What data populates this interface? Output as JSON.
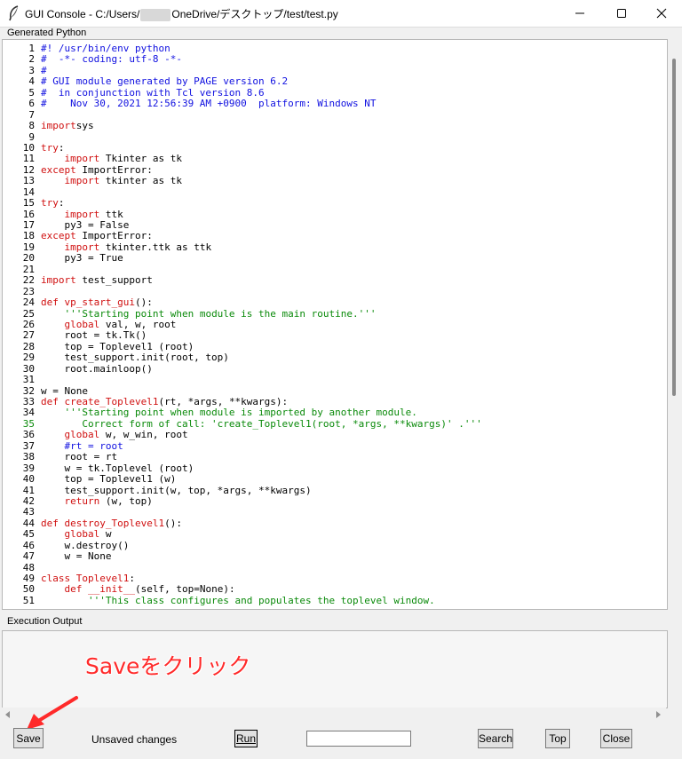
{
  "window": {
    "title_prefix": "GUI Console - C:/Users/",
    "title_suffix": "OneDrive/デスクトップ/test/test.py"
  },
  "editor": {
    "label": "Generated Python",
    "lines": [
      [
        [
          "cm",
          "#! /usr/bin/env python"
        ]
      ],
      [
        [
          "cm",
          "#  -*- coding: utf-8 -*-"
        ]
      ],
      [
        [
          "cm",
          "#"
        ]
      ],
      [
        [
          "cm",
          "# GUI module generated by PAGE version 6.2"
        ]
      ],
      [
        [
          "cm",
          "#  in conjunction with Tcl version 8.6"
        ]
      ],
      [
        [
          "cm",
          "#    Nov 30, 2021 12:56:39 AM +0900  platform: Windows NT"
        ]
      ],
      [],
      [
        [
          "kw",
          "import"
        ],
        [
          "",
          "sys"
        ]
      ],
      [],
      [
        [
          "kw",
          "try"
        ],
        [
          "",
          ":"
        ]
      ],
      [
        [
          "",
          "    "
        ],
        [
          "kw",
          "import"
        ],
        [
          "",
          " Tkinter as tk"
        ]
      ],
      [
        [
          "kw",
          "except"
        ],
        [
          "",
          " ImportError:"
        ]
      ],
      [
        [
          "",
          "    "
        ],
        [
          "kw",
          "import"
        ],
        [
          "",
          " tkinter as tk"
        ]
      ],
      [],
      [
        [
          "kw",
          "try"
        ],
        [
          "",
          ":"
        ]
      ],
      [
        [
          "",
          "    "
        ],
        [
          "kw",
          "import"
        ],
        [
          "",
          " ttk"
        ]
      ],
      [
        [
          "",
          "    py3 = False"
        ]
      ],
      [
        [
          "kw",
          "except"
        ],
        [
          "",
          " ImportError:"
        ]
      ],
      [
        [
          "",
          "    "
        ],
        [
          "kw",
          "import"
        ],
        [
          "",
          " tkinter.ttk as ttk"
        ]
      ],
      [
        [
          "",
          "    py3 = True"
        ]
      ],
      [],
      [
        [
          "kw",
          "import"
        ],
        [
          "",
          " test_support"
        ]
      ],
      [],
      [
        [
          "kw",
          "def"
        ],
        [
          "",
          " "
        ],
        [
          "fn",
          "vp_start_gui"
        ],
        [
          "",
          "():"
        ]
      ],
      [
        [
          "",
          "    "
        ],
        [
          "st",
          "'''Starting point when module is the main routine.'''"
        ]
      ],
      [
        [
          "",
          "    "
        ],
        [
          "kw",
          "global"
        ],
        [
          "",
          " val, w, root"
        ]
      ],
      [
        [
          "",
          "    root = tk.Tk()"
        ]
      ],
      [
        [
          "",
          "    top = Toplevel1 (root)"
        ]
      ],
      [
        [
          "",
          "    test_support.init(root, top)"
        ]
      ],
      [
        [
          "",
          "    root.mainloop()"
        ]
      ],
      [],
      [
        [
          "",
          "w = None"
        ]
      ],
      [
        [
          "kw",
          "def"
        ],
        [
          "",
          " "
        ],
        [
          "fn",
          "create_Toplevel1"
        ],
        [
          "",
          "(rt, *args, **kwargs):"
        ]
      ],
      [
        [
          "",
          "    "
        ],
        [
          "st",
          "'''Starting point when module is imported by another module."
        ]
      ],
      [
        [
          "st",
          "       Correct form of call: 'create_Toplevel1(root, *args, **kwargs)' .'''"
        ]
      ],
      [
        [
          "",
          "    "
        ],
        [
          "kw",
          "global"
        ],
        [
          "",
          " w, w_win, root"
        ]
      ],
      [
        [
          "",
          "    "
        ],
        [
          "cm",
          "#rt = root"
        ]
      ],
      [
        [
          "",
          "    root = rt"
        ]
      ],
      [
        [
          "",
          "    w = tk.Toplevel (root)"
        ]
      ],
      [
        [
          "",
          "    top = Toplevel1 (w)"
        ]
      ],
      [
        [
          "",
          "    test_support.init(w, top, *args, **kwargs)"
        ]
      ],
      [
        [
          "",
          "    "
        ],
        [
          "kw",
          "return"
        ],
        [
          "",
          " (w, top)"
        ]
      ],
      [],
      [
        [
          "kw",
          "def"
        ],
        [
          "",
          " "
        ],
        [
          "fn",
          "destroy_Toplevel1"
        ],
        [
          "",
          "():"
        ]
      ],
      [
        [
          "",
          "    "
        ],
        [
          "kw",
          "global"
        ],
        [
          "",
          " w"
        ]
      ],
      [
        [
          "",
          "    w.destroy()"
        ]
      ],
      [
        [
          "",
          "    w = None"
        ]
      ],
      [],
      [
        [
          "kw",
          "class"
        ],
        [
          "",
          " "
        ],
        [
          "cls",
          "Toplevel1"
        ],
        [
          "",
          ":"
        ]
      ],
      [
        [
          "",
          "    "
        ],
        [
          "kw",
          "def"
        ],
        [
          "",
          " "
        ],
        [
          "fn",
          "__init__"
        ],
        [
          "",
          "(self, top=None):"
        ]
      ],
      [
        [
          "",
          "        "
        ],
        [
          "st",
          "'''This class configures and populates the toplevel window."
        ]
      ]
    ]
  },
  "output": {
    "label": "Execution Output"
  },
  "annotation": {
    "text": "Saveをクリック",
    "color": "#ff2a2a"
  },
  "buttons": {
    "save": "Save",
    "run": "Run",
    "search": "Search",
    "top": "Top",
    "close": "Close"
  },
  "status": {
    "text": "Unsaved changes"
  },
  "search_field": {
    "value": ""
  }
}
